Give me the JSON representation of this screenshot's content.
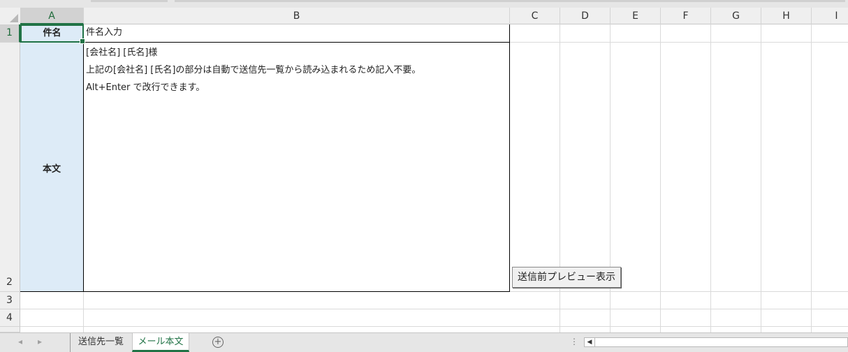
{
  "columns": [
    "A",
    "B",
    "C",
    "D",
    "E",
    "F",
    "G",
    "H",
    "I"
  ],
  "rows": [
    "1",
    "2",
    "3",
    "4"
  ],
  "cells": {
    "A1": "件名",
    "A2": "本文",
    "B1": "件名入力",
    "B2_lines": [
      "[会社名] [氏名]様",
      "上記の[会社名] [氏名]の部分は自動で送信先一覧から読み込まれるため記入不要。",
      "Alt+Enter で改行できます。"
    ]
  },
  "button": {
    "label": "送信前プレビュー表示"
  },
  "sheet_tabs": [
    {
      "label": "送信先一覧",
      "active": false
    },
    {
      "label": "メール本文",
      "active": true
    }
  ],
  "bottom": {
    "add_sheet_symbol": "+",
    "more_symbol": "⋮"
  },
  "colors": {
    "accent": "#217346",
    "header_cell_fill": "#ddebf7"
  }
}
